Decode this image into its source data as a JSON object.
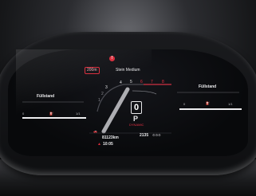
{
  "cluster": {
    "nav_distance": "200m",
    "destination": "Stein Medium",
    "left_panel_label": "Füllstand",
    "left_panel_max": "1/1",
    "left_panel_min": "0",
    "right_panel_label": "Füllstand",
    "right_panel_max": "1/1",
    "right_panel_min": "0",
    "gear_numbers": [
      "1",
      "2",
      "3",
      "4",
      "5",
      "6",
      "7",
      "8"
    ],
    "gear_selected": "0",
    "gear_mode": "P",
    "drive_mode": "DYNAMIC",
    "odometer": "81123km",
    "clock": "10:05",
    "range": "2135",
    "warning_symbol": "!",
    "status_icons": [
      "car-icon",
      "warning-icon",
      "gear-p-icon"
    ]
  }
}
